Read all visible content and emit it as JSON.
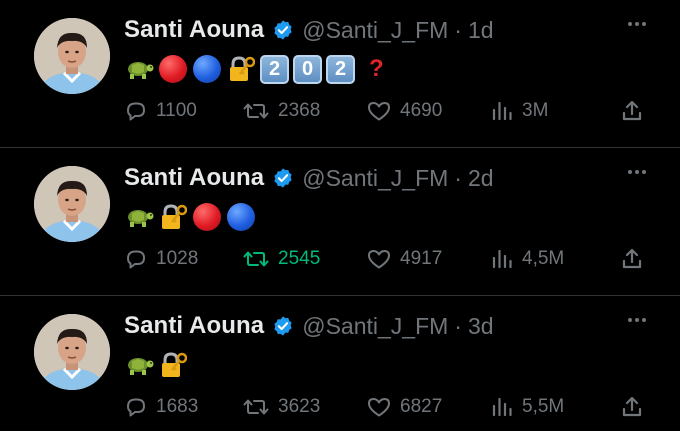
{
  "tweets": [
    {
      "name": "Santi Aouna",
      "handle": "@Santi_J_FM",
      "separator": "·",
      "time": "1d",
      "content": [
        "turtle",
        "red-circle",
        "blue-circle",
        "locked-with-key",
        "keycap-2",
        "keycap-0",
        "keycap-2",
        "red-question-mark"
      ],
      "keycap_digits": [
        "2",
        "0",
        "2"
      ],
      "question_mark": "?",
      "replies": "1100",
      "retweets": "2368",
      "retweet_active": false,
      "likes": "4690",
      "views": "3M"
    },
    {
      "name": "Santi Aouna",
      "handle": "@Santi_J_FM",
      "separator": "·",
      "time": "2d",
      "content": [
        "turtle",
        "locked-with-key",
        "red-circle",
        "blue-circle"
      ],
      "replies": "1028",
      "retweets": "2545",
      "retweet_active": true,
      "likes": "4917",
      "views": "4,5M"
    },
    {
      "name": "Santi Aouna",
      "handle": "@Santi_J_FM",
      "separator": "·",
      "time": "3d",
      "content": [
        "turtle",
        "locked-with-key"
      ],
      "replies": "1683",
      "retweets": "3623",
      "retweet_active": false,
      "likes": "6827",
      "views": "5,5M"
    }
  ],
  "colors": {
    "background": "#000000",
    "text": "#e7e9ea",
    "muted": "#71767b",
    "verified": "#1d9bf0",
    "retweet_active": "#00ba7c",
    "divider": "#2f3336"
  },
  "icons": {
    "reply": "reply-icon",
    "retweet": "retweet-icon",
    "like": "heart-icon",
    "views": "views-icon",
    "share": "share-icon",
    "verified": "verified-badge-icon",
    "more": "more-dots-icon"
  }
}
